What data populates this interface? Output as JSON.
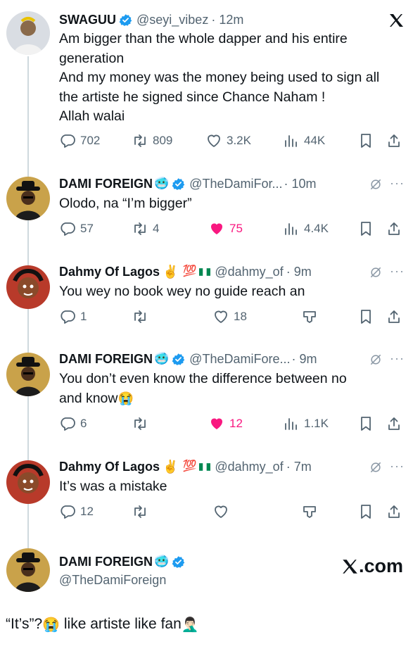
{
  "colors": {
    "text": "#0f1419",
    "muted": "#536471",
    "verified": "#1d9bf0",
    "like_active": "#f91880",
    "thread_line": "#cfd9de"
  },
  "tweets": [
    {
      "name": "SWAGUU",
      "handle": "@seyi_vibez",
      "time": "· 12m",
      "verified": true,
      "lines": [
        "Am bigger than the whole dapper and his entire",
        "generation",
        "And my money was the money being used to sign all",
        "the artiste he signed since Chance  Naham !",
        "Allah walai"
      ],
      "reply_count": "702",
      "retweet_count": "809",
      "like_count": "3.2K",
      "like_active": false,
      "view_count": "44K"
    },
    {
      "name": "DAMI FOREIGN",
      "handle": "@TheDamiFor...",
      "time": "· 10m",
      "verified": true,
      "lines": [
        "Olodo, na “I’m bigger”"
      ],
      "reply_count": "57",
      "retweet_count": "4",
      "like_count": "75",
      "like_active": true,
      "view_count": "4.4K"
    },
    {
      "name": "Dahmy Of Lagos",
      "handle": "@dahmy_of",
      "time": "· 9m",
      "verified": false,
      "lines": [
        "You wey no book wey no guide reach an"
      ],
      "reply_count": "1",
      "retweet_count": "",
      "like_count": "18",
      "like_active": false,
      "view_count": ""
    },
    {
      "name": "DAMI FOREIGN",
      "handle": "@TheDamiFore...",
      "time": "· 9m",
      "verified": true,
      "lines": [
        "You don’t even know the difference between no",
        "and know"
      ],
      "reply_count": "6",
      "retweet_count": "",
      "like_count": "12",
      "like_active": true,
      "view_count": "1.1K"
    },
    {
      "name": "Dahmy Of Lagos",
      "handle": "@dahmy_of",
      "time": "· 7m",
      "verified": false,
      "lines": [
        "It’s was a mistake"
      ],
      "reply_count": "12",
      "retweet_count": "",
      "like_count": "",
      "like_active": false,
      "view_count": ""
    }
  ],
  "footer": {
    "name": "DAMI FOREIGN",
    "handle": "@TheDamiForeign",
    "site": ".com",
    "quote": "“It’s”?",
    "quote_tail": " like artiste like fan"
  },
  "icons": {
    "verified": "verified-badge-icon",
    "reply": "reply-icon",
    "retweet": "retweet-icon",
    "like": "heart-icon",
    "views": "views-icon",
    "bookmark": "bookmark-icon",
    "share": "share-icon",
    "grok": "grok-icon",
    "more": "more-dots-icon",
    "tip": "tip-money-icon",
    "x_logo": "x-logo-icon"
  }
}
